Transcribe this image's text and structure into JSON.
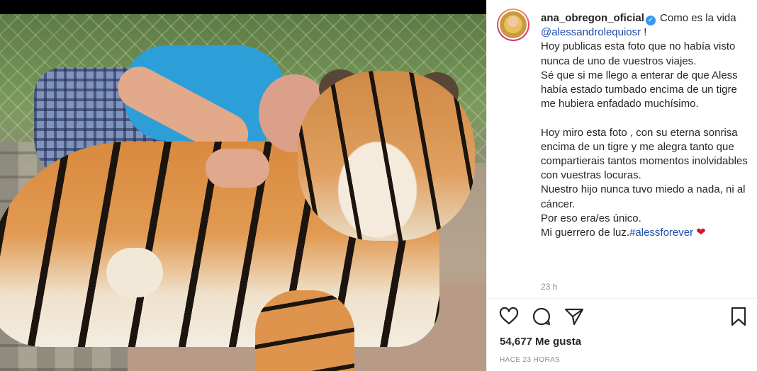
{
  "post": {
    "photo_alt": "",
    "username": "ana_obregon_oficial",
    "caption_before_mention": " Como es la vida ",
    "mention": "@alessandrolequiosr",
    "caption_after_mention": " !\nHoy publicas esta foto que no había visto nunca de uno de vuestros viajes.\nSé que si me llego a enterar de que Aless había estado tumbado encima de un tigre me hubiera enfadado muchísimo.\n\nHoy miro esta foto , con su eterna sonrisa encima de un tigre y me alegra tanto que compartierais tantos momentos inolvidables con vuestras locuras.\nNuestro hijo nunca tuvo miedo a nada, ni al cáncer.\nPor eso era/es único.\nMi guerrero de luz.",
    "hashtag": "#alessforever",
    "caption_emoji": "❤",
    "time_ago": "23 h",
    "likes": "54,677 Me gusta",
    "posted_label": "HACE 23 HORAS"
  },
  "icons": {
    "verified": "verified-badge-icon",
    "like": "heart-icon",
    "comment": "comment-icon",
    "share": "share-icon",
    "save": "bookmark-icon"
  },
  "colors": {
    "link": "#1a4aa8",
    "text": "#262626",
    "muted": "#8e8e8e",
    "verified": "#3897f0",
    "heart_emoji": "#d3132f"
  }
}
